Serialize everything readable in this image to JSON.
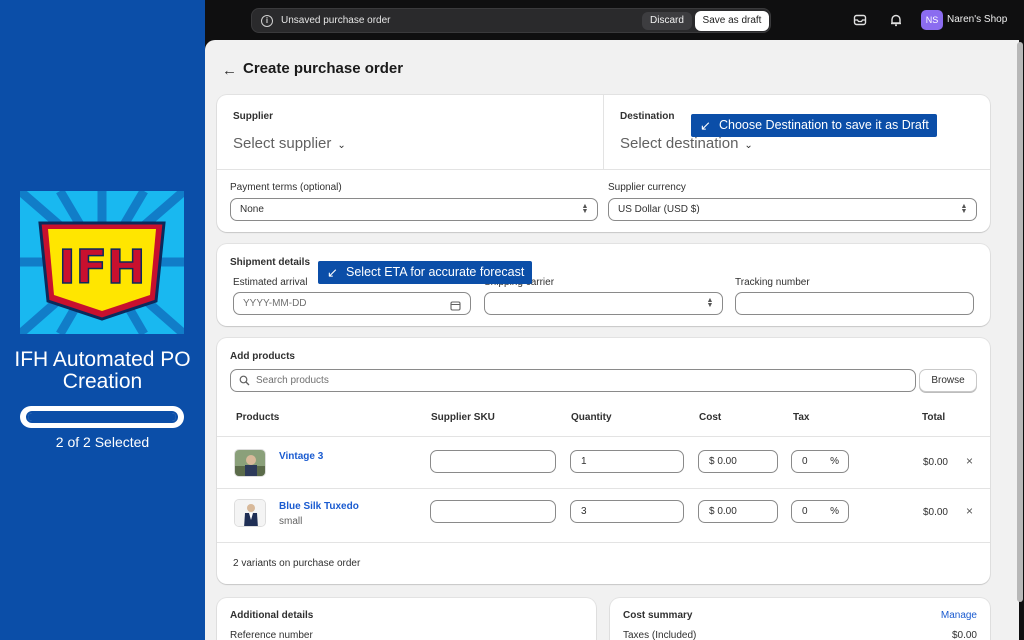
{
  "promo": {
    "logo_text": "IFH",
    "app_name_line1": "IFH Automated PO",
    "app_name_line2": "Creation",
    "progress_fraction": 1.0,
    "selected_text": "2 of 2 Selected"
  },
  "topbar": {
    "unsaved_message": "Unsaved purchase order",
    "discard_label": "Discard",
    "save_draft_label": "Save as draft",
    "avatar_initials": "NS",
    "shop_name": "Naren's Shop"
  },
  "page": {
    "title": "Create purchase order"
  },
  "supplier_card": {
    "supplier_label": "Supplier",
    "supplier_value": "Select supplier",
    "destination_label": "Destination",
    "destination_value": "Select destination",
    "destination_callout": "Choose Destination to save it as Draft",
    "payment_terms_label": "Payment terms (optional)",
    "payment_terms_value": "None",
    "currency_label": "Supplier currency",
    "currency_value": "US Dollar (USD $)"
  },
  "shipment_card": {
    "title": "Shipment details",
    "eta_label": "Estimated arrival",
    "eta_placeholder": "YYYY-MM-DD",
    "eta_callout": "Select ETA for accurate forecast",
    "carrier_label": "Shipping carrier",
    "tracking_label": "Tracking number"
  },
  "products_card": {
    "title": "Add products",
    "search_placeholder": "Search products",
    "browse_label": "Browse",
    "columns": {
      "products": "Products",
      "sku": "Supplier SKU",
      "quantity": "Quantity",
      "cost": "Cost",
      "tax": "Tax",
      "total": "Total"
    },
    "rows": [
      {
        "name": "Vintage 3",
        "variant": "",
        "sku": "",
        "quantity": "1",
        "cost_prefix": "$",
        "cost": "0.00",
        "tax": "0",
        "tax_suffix": "%",
        "total": "$0.00"
      },
      {
        "name": "Blue Silk Tuxedo",
        "variant": "small",
        "sku": "",
        "quantity": "3",
        "cost_prefix": "$",
        "cost": "0.00",
        "tax": "0",
        "tax_suffix": "%",
        "total": "$0.00"
      }
    ],
    "footer": "2 variants on purchase order"
  },
  "additional_card": {
    "title": "Additional details",
    "reference_label": "Reference number"
  },
  "cost_card": {
    "title": "Cost summary",
    "manage_label": "Manage",
    "taxes_label": "Taxes (Included)",
    "taxes_value": "$0.00"
  },
  "colors": {
    "brand_blue": "#0b4ea8",
    "link_blue": "#1a5bd0",
    "avatar_purple": "#8b6cf0"
  }
}
